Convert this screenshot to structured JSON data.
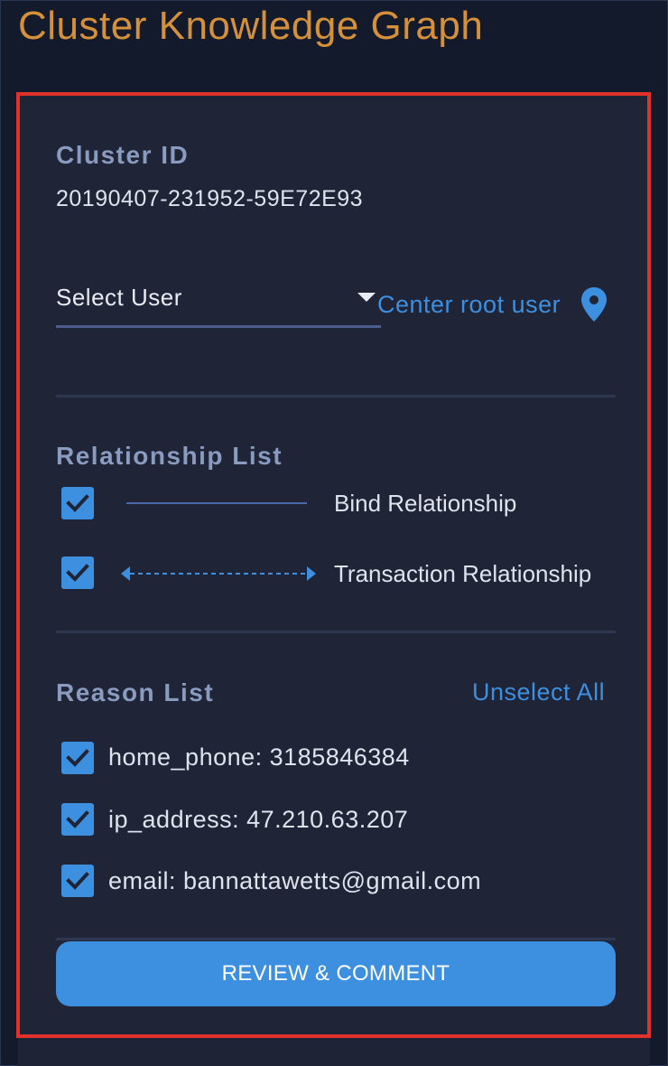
{
  "app": {
    "title": "Cluster Knowledge Graph"
  },
  "cluster": {
    "label": "Cluster ID",
    "id": "20190407-231952-59E72E93"
  },
  "user_select": {
    "value": "Select User",
    "center_link": "Center root user",
    "center_icon": "location-pin-icon"
  },
  "relationships": {
    "title": "Relationship List",
    "items": [
      {
        "label": "Bind Relationship",
        "checked": true,
        "line_style": "solid"
      },
      {
        "label": "Transaction Relationship",
        "checked": true,
        "line_style": "dashed-bidirectional-arrow"
      }
    ]
  },
  "reasons": {
    "title": "Reason List",
    "unselect_all": "Unselect All",
    "items": [
      {
        "label": "home_phone: 3185846384",
        "checked": true
      },
      {
        "label": "ip_address: 47.210.63.207",
        "checked": true
      },
      {
        "label": "email: bannattawetts@gmail.com",
        "checked": true
      }
    ]
  },
  "actions": {
    "review_label": "REVIEW & COMMENT"
  },
  "colors": {
    "accent": "#3d8fe0",
    "title": "#d4903a",
    "panel_border": "#e0312b",
    "panel_bg": "#1f2437",
    "page_bg": "#121a2b"
  }
}
